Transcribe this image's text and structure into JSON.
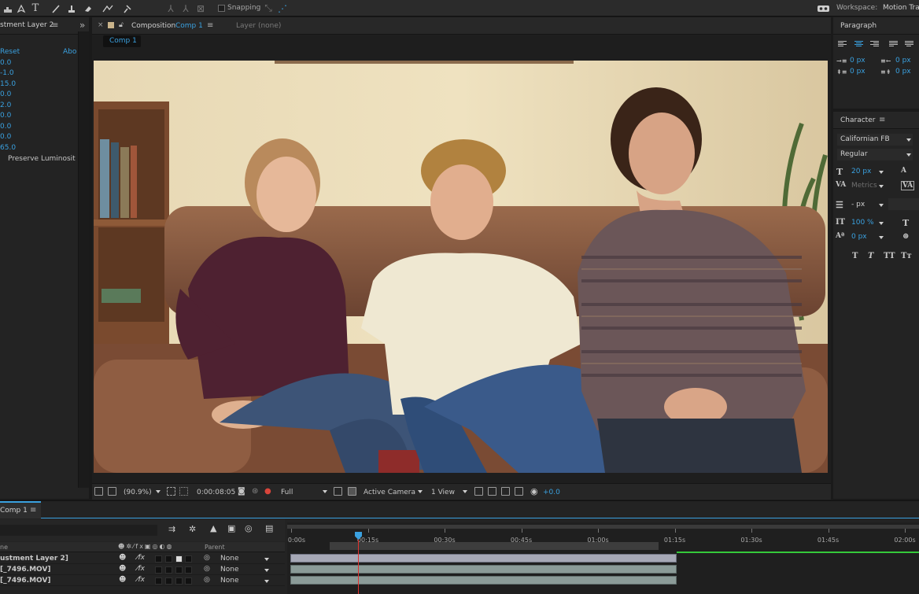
{
  "toolbar": {
    "snapping_label": "Snapping",
    "workspace_label": "Workspace:",
    "workspace_value": "Motion Tra"
  },
  "effect_controls": {
    "tab_title": "stment Layer 2",
    "reset_label": "Reset",
    "about_label": "Abo",
    "values": [
      "0.0",
      "-1.0",
      "15.0",
      "0.0",
      "2.0",
      "0.0",
      "0.0",
      "0.0",
      "65.0"
    ],
    "preserve_label": "Preserve Luminosit"
  },
  "composition": {
    "close_label": "×",
    "tab_prefix": "Composition",
    "tab_comp_name": "Comp 1",
    "layer_tab": "Layer (none)",
    "breadcrumb": "Comp 1",
    "footer": {
      "zoom": "(90.9%)",
      "timecode": "0:00:08:05",
      "resolution": "Full",
      "camera": "Active Camera",
      "views": "1 View",
      "exposure": "+0.0"
    }
  },
  "paragraph": {
    "title": "Paragraph",
    "indent_left": "0 px",
    "indent_right": "0 px",
    "space_before": "0 px",
    "space_after": "0 px"
  },
  "character": {
    "title": "Character",
    "font_family": "Californian FB",
    "font_style": "Regular",
    "font_size": "20 px",
    "kerning": "Metrics",
    "leading": "- px",
    "vertical_scale": "100 %",
    "baseline_shift": "0 px",
    "style_buttons": [
      "T",
      "T",
      "TT",
      "Tт"
    ]
  },
  "timeline": {
    "tab_title": "Comp 1",
    "header_name": "ne",
    "header_parent": "Parent",
    "layers": [
      {
        "name": "ustment Layer 2]",
        "parent": "None"
      },
      {
        "name": "[_7496.MOV]",
        "parent": "None"
      },
      {
        "name": "[_7496.MOV]",
        "parent": "None"
      }
    ],
    "ruler": [
      "0:00s",
      "00:15s",
      "00:30s",
      "00:45s",
      "01:00s",
      "01:15s",
      "01:30s",
      "01:45s",
      "02:00s"
    ],
    "playhead_time_fraction": 0.109,
    "work_area_end_fraction": 0.6,
    "layer_end_fraction": 0.635
  },
  "colors": {
    "accent": "#3aa1e0",
    "playhead": "#e0322e",
    "bar": "#8b9b98",
    "green": "#35c93a"
  }
}
